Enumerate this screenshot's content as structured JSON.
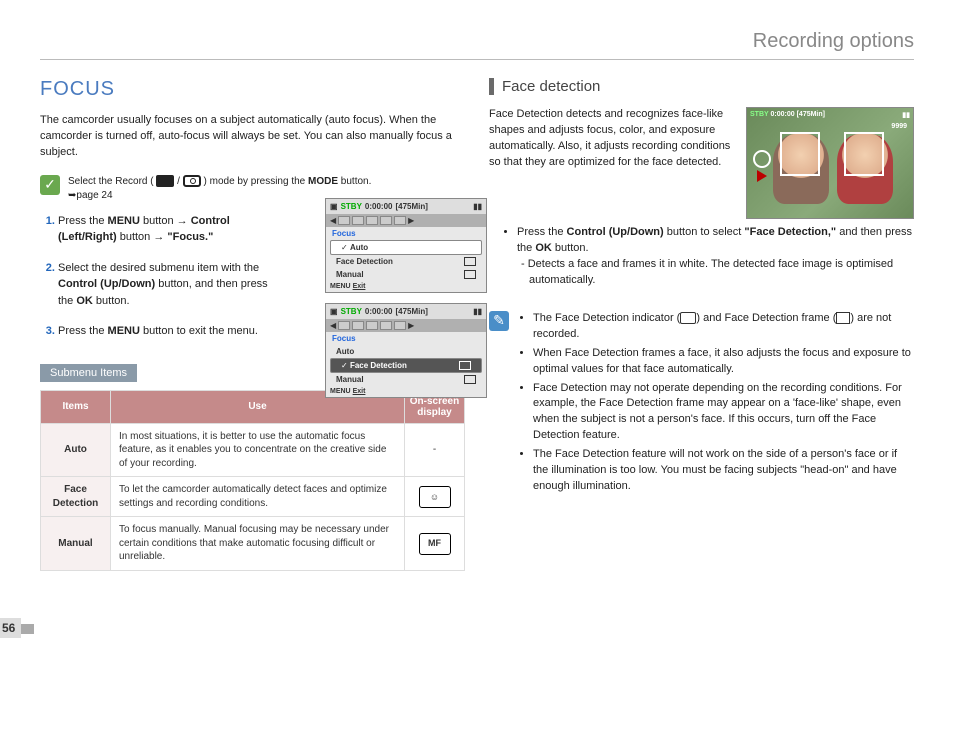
{
  "header": {
    "title": "Recording options"
  },
  "page_number": "56",
  "left": {
    "title": "FOCUS",
    "intro": "The camcorder usually focuses on a subject automatically (auto focus). When the camcorder is turned off, auto-focus will always be set. You can also manually focus a subject.",
    "note_prefix": "Select the Record (",
    "note_sep": " / ",
    "note_mid": ") mode by pressing the ",
    "note_mode": "MODE",
    "note_suffix": " button.",
    "note_page": "➥page 24",
    "steps": [
      {
        "t1": "Press the ",
        "b1": "MENU",
        "t2": " button → ",
        "b2": "Control (Left/Right)",
        "t3": " button → ",
        "b3": "\"Focus.\""
      },
      {
        "t1": "Select the desired submenu item with the ",
        "b1": "Control (Up/Down)",
        "t2": " button, and then press the ",
        "b2": "OK",
        "t3": " button."
      },
      {
        "t1": "Press the ",
        "b1": "MENU",
        "t2": " button to exit the menu."
      }
    ],
    "submenu_badge": "Submenu Items",
    "table": {
      "headers": {
        "items": "Items",
        "use": "Use",
        "osd": "On-screen display"
      },
      "rows": [
        {
          "name": "Auto",
          "use": "In most situations, it is better to use the automatic focus feature, as it enables you to concentrate on the creative side of your recording.",
          "osd": "-"
        },
        {
          "name": "Face Detection",
          "use": "To let the camcorder automatically detect faces and optimize settings and recording conditions.",
          "osd": "icon"
        },
        {
          "name": "Manual",
          "use": "To focus manually. Manual focusing may be necessary under certain conditions that make automatic focusing difficult or unreliable.",
          "osd": "icon"
        }
      ]
    },
    "lcd": {
      "stby": "STBY",
      "time": "0:00:00",
      "remain": "[475Min]",
      "section": "Focus",
      "auto": "Auto",
      "face": "Face Detection",
      "manual": "Manual",
      "menu": "MENU",
      "exit": "Exit"
    }
  },
  "right": {
    "title": "Face detection",
    "intro": "Face Detection detects and recognizes face-like shapes and adjusts focus, color, and exposure automatically. Also, it adjusts recording conditions so that they are optimized for the face detected.",
    "thumb": {
      "stby": "STBY",
      "time": "0:00:00",
      "remain": "[475Min]",
      "count": "9999"
    },
    "bullet1": {
      "t1": "Press the ",
      "b1": "Control (Up/Down)",
      "t2": " button to select ",
      "b2": "\"Face Detection,\"",
      "t3": " and then press the ",
      "b3": "OK",
      "t4": " button.",
      "sub": "Detects a face and frames it in white. The detected face image is optimised automatically."
    },
    "notes": [
      "The Face Detection indicator ( ) and Face Detection frame ( ) are not recorded.",
      "When Face Detection frames a face, it also adjusts the focus and exposure to optimal values for that face automatically.",
      "Face Detection may not operate depending on the recording conditions. For example, the Face Detection frame may appear on a 'face-like' shape, even when the subject is not a person's face. If this occurs, turn off the Face Detection feature.",
      "The Face Detection feature will not work on the side of a person's face or if the illumination is too low. You must be facing subjects \"head-on\" and have enough illumination."
    ],
    "note_parts": {
      "n1a": "The Face Detection indicator (",
      "n1b": ") and Face Detection frame (",
      "n1c": ") are not recorded."
    }
  }
}
